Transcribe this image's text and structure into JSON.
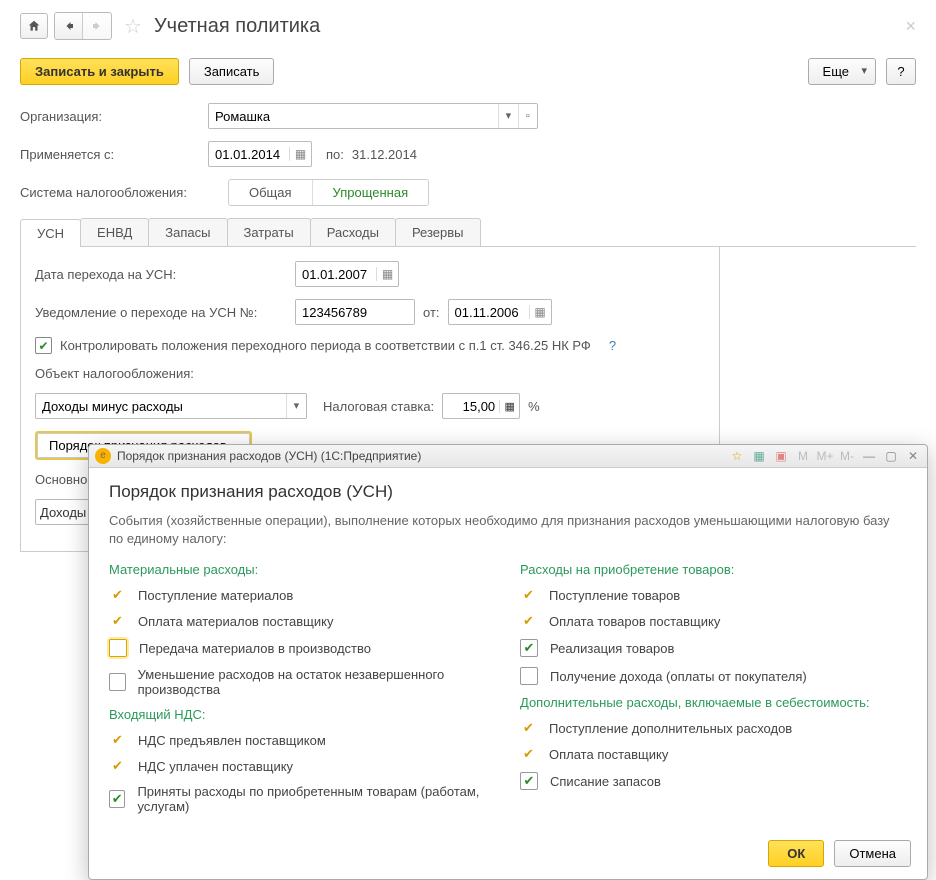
{
  "header": {
    "title": "Учетная политика"
  },
  "actions": {
    "save_close": "Записать и закрыть",
    "save": "Записать",
    "more": "Еще",
    "help": "?"
  },
  "form": {
    "org_label": "Организация:",
    "org_value": "Ромашка",
    "applies_from_label": "Применяется с:",
    "applies_from_value": "01.01.2014",
    "to_label": "по:",
    "to_value": "31.12.2014",
    "tax_system_label": "Система налогообложения:",
    "tax_general": "Общая",
    "tax_simple": "Упрощенная"
  },
  "tabs": [
    "УСН",
    "ЕНВД",
    "Запасы",
    "Затраты",
    "Расходы",
    "Резервы"
  ],
  "usn_panel": {
    "date_transition_label": "Дата перехода на УСН:",
    "date_transition_value": "01.01.2007",
    "notice_label": "Уведомление о переходе на УСН №:",
    "notice_value": "123456789",
    "from_label": "от:",
    "notice_date": "01.11.2006",
    "control_text": "Контролировать положения переходного периода в соответствии с п.1 ст. 346.25 НК РФ",
    "object_label": "Объект налогообложения:",
    "object_value": "Доходы минус расходы",
    "rate_label": "Налоговая ставка:",
    "rate_value": "15,00",
    "rate_unit": "%",
    "order_btn": "Порядок признания расходов...",
    "main_label": "Основной",
    "income_value": "Доходы"
  },
  "dialog": {
    "title_bar": "Порядок признания расходов (УСН)  (1С:Предприятие)",
    "heading": "Порядок признания расходов (УСН)",
    "desc": "События (хозяйственные операции), выполнение которых необходимо для признания расходов уменьшающими налоговую базу по единому налогу:",
    "title_icons": [
      "M",
      "M+",
      "M-"
    ],
    "sections": {
      "mat": {
        "title": "Материальные расходы:",
        "items": [
          {
            "kind": "tick",
            "label": "Поступление материалов"
          },
          {
            "kind": "tick",
            "label": "Оплата материалов поставщику"
          },
          {
            "kind": "box_hl",
            "label": "Передача материалов в производство"
          },
          {
            "kind": "box",
            "label": "Уменьшение расходов на остаток незавершенного производства"
          }
        ]
      },
      "vat": {
        "title": "Входящий НДС:",
        "items": [
          {
            "kind": "tick",
            "label": "НДС предъявлен поставщиком"
          },
          {
            "kind": "tick",
            "label": "НДС уплачен поставщику"
          },
          {
            "kind": "box_checked",
            "label": "Приняты расходы по приобретенным товарам (работам, услугам)"
          }
        ]
      },
      "goods": {
        "title": "Расходы на приобретение товаров:",
        "items": [
          {
            "kind": "tick",
            "label": "Поступление товаров"
          },
          {
            "kind": "tick",
            "label": "Оплата товаров поставщику"
          },
          {
            "kind": "box_checked",
            "label": "Реализация товаров"
          },
          {
            "kind": "box",
            "label": "Получение дохода (оплаты от покупателя)"
          }
        ]
      },
      "extra": {
        "title": "Дополнительные расходы, включаемые в себестоимость:",
        "items": [
          {
            "kind": "tick",
            "label": "Поступление дополнительных расходов"
          },
          {
            "kind": "tick",
            "label": "Оплата поставщику"
          },
          {
            "kind": "box_checked",
            "label": "Списание запасов"
          }
        ]
      }
    },
    "ok": "ОК",
    "cancel": "Отмена"
  }
}
